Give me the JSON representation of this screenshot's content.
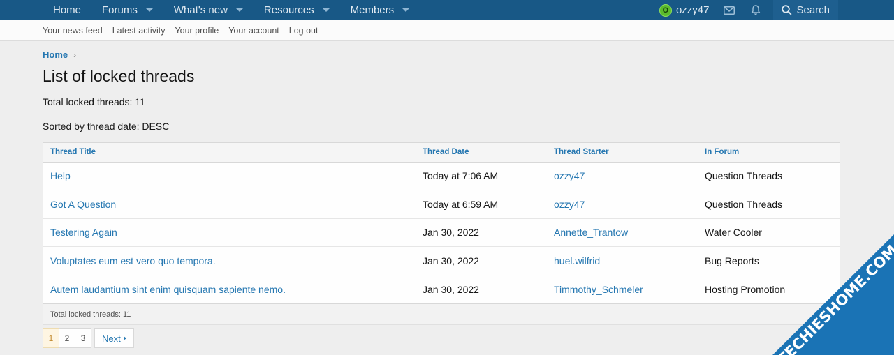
{
  "nav": {
    "items": [
      {
        "label": "Home",
        "has_menu": false
      },
      {
        "label": "Forums",
        "has_menu": true
      },
      {
        "label": "What's new",
        "has_menu": true
      },
      {
        "label": "Resources",
        "has_menu": true
      },
      {
        "label": "Members",
        "has_menu": true
      }
    ],
    "user": {
      "name": "ozzy47",
      "avatar_letter": "O",
      "avatar_color": "#5bbb2d"
    },
    "icons": [
      "mail-icon",
      "bell-icon"
    ],
    "search_label": "Search"
  },
  "subnav": {
    "items": [
      "Your news feed",
      "Latest activity",
      "Your profile",
      "Your account",
      "Log out"
    ]
  },
  "breadcrumb": {
    "home": "Home"
  },
  "page": {
    "title": "List of locked threads",
    "total": "Total locked threads: 11",
    "sorted": "Sorted by thread date: DESC"
  },
  "table": {
    "headers": [
      "Thread Title",
      "Thread Date",
      "Thread Starter",
      "In Forum"
    ],
    "rows": [
      [
        "Help",
        "Today at 7:06 AM",
        "ozzy47",
        "Question Threads"
      ],
      [
        "Got A Question",
        "Today at 6:59 AM",
        "ozzy47",
        "Question Threads"
      ],
      [
        "Testering Again",
        "Jan 30, 2022",
        "Annette_Trantow",
        "Water Cooler"
      ],
      [
        "Voluptates eum est vero quo tempora.",
        "Jan 30, 2022",
        "huel.wilfrid",
        "Bug Reports"
      ],
      [
        "Autem laudantium sint enim quisquam sapiente nemo.",
        "Jan 30, 2022",
        "Timmothy_Schmeler",
        "Hosting Promotion"
      ]
    ],
    "footer": "Total locked threads: 11"
  },
  "pager": {
    "pages": [
      "1",
      "2",
      "3"
    ],
    "current": "1",
    "next_label": "Next"
  },
  "watermark": {
    "text": "TECHIESHOME.COM"
  },
  "colors": {
    "nav_bg": "#185886",
    "link": "#2577b1",
    "accent_current_page": "#fef5e2"
  }
}
